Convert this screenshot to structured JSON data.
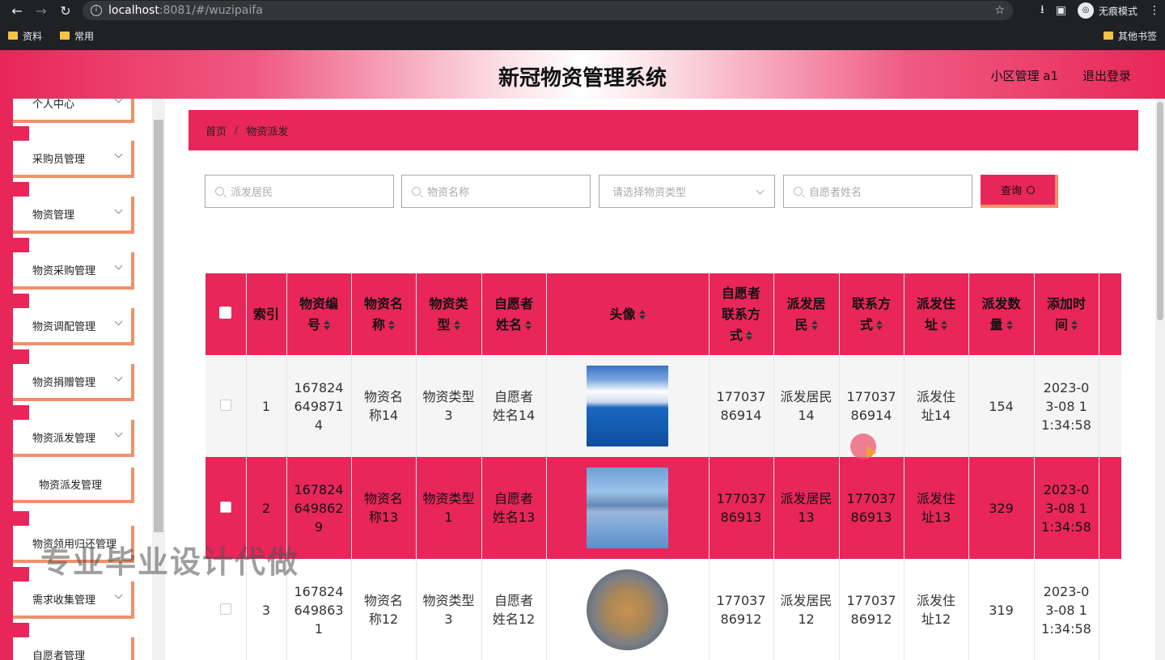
{
  "browser": {
    "url_host": "localhost",
    "url_path": ":8081/#/wuzipaifa",
    "incognito_label": "无痕模式",
    "bookmarks": [
      "资料",
      "常用"
    ],
    "bookmarks_right": "其他书签"
  },
  "header": {
    "title": "新冠物资管理系统",
    "user": "小区管理 a1",
    "logout": "退出登录"
  },
  "sidebar": {
    "items": [
      {
        "label": "个人中心"
      },
      {
        "label": "采购员管理"
      },
      {
        "label": "物资管理"
      },
      {
        "label": "物资采购管理"
      },
      {
        "label": "物资调配管理"
      },
      {
        "label": "物资捐赠管理"
      },
      {
        "label": "物资派发管理"
      },
      {
        "label": "物资派发管理"
      },
      {
        "label": "物资领用归还管理"
      },
      {
        "label": "需求收集管理"
      },
      {
        "label": "自愿者管理"
      }
    ]
  },
  "breadcrumb": {
    "home": "首页",
    "sep": "/",
    "current": "物资派发"
  },
  "search": {
    "resident_placeholder": "派发居民",
    "name_placeholder": "物资名称",
    "type_placeholder": "请选择物资类型",
    "volunteer_placeholder": "自愿者姓名",
    "query_label": "查询"
  },
  "table": {
    "headers": [
      "索引",
      "物资编号",
      "物资名称",
      "物资类型",
      "自愿者姓名",
      "头像",
      "自愿者联系方式",
      "派发居民",
      "联系方式",
      "派发住址",
      "派发数量",
      "添加时间"
    ],
    "rows": [
      {
        "index": "1",
        "code": "1678246498714",
        "name": "物资名称14",
        "type": "物资类型3",
        "volunteer": "自愿者姓名14",
        "phone": "17703786914",
        "resident": "派发居民14",
        "contact": "17703786914",
        "address": "派发住址14",
        "qty": "154",
        "time": "2023-03-08 11:34:58"
      },
      {
        "index": "2",
        "code": "1678246498629",
        "name": "物资名称13",
        "type": "物资类型1",
        "volunteer": "自愿者姓名13",
        "phone": "17703786913",
        "resident": "派发居民13",
        "contact": "17703786913",
        "address": "派发住址13",
        "qty": "329",
        "time": "2023-03-08 11:34:58"
      },
      {
        "index": "3",
        "code": "1678246498631",
        "name": "物资名称12",
        "type": "物资类型3",
        "volunteer": "自愿者姓名12",
        "phone": "17703786912",
        "resident": "派发居民12",
        "contact": "17703786912",
        "address": "派发住址12",
        "qty": "319",
        "time": "2023-03-08 11:34:58"
      }
    ]
  },
  "watermark": "专业毕业设计代做",
  "colors": {
    "accent": "#e8265a",
    "shadow": "#f0906a"
  }
}
